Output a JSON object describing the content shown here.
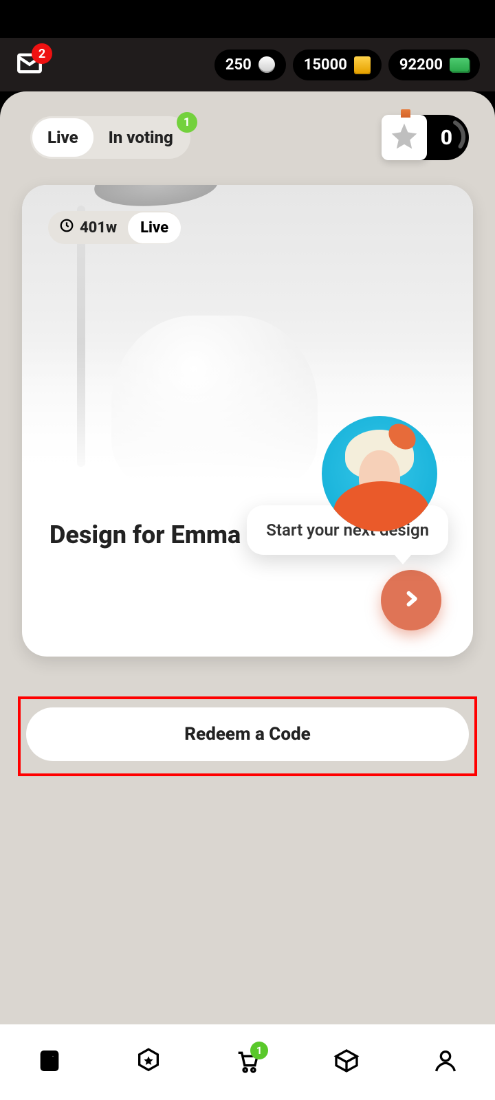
{
  "header": {
    "mail_badge": "2",
    "currencies": [
      {
        "amount": "250",
        "icon": "coins"
      },
      {
        "amount": "15000",
        "icon": "gold"
      },
      {
        "amount": "92200",
        "icon": "cash"
      }
    ]
  },
  "tabs": {
    "live": "Live",
    "in_voting": "In voting",
    "in_voting_badge": "1"
  },
  "star_counter": {
    "count": "0"
  },
  "card": {
    "time_label": "401w",
    "status_label": "Live",
    "title": "Design for Emma",
    "tooltip": "Start your next design"
  },
  "redeem": {
    "label": "Redeem a Code"
  },
  "bottom_nav": {
    "cart_badge": "1"
  }
}
